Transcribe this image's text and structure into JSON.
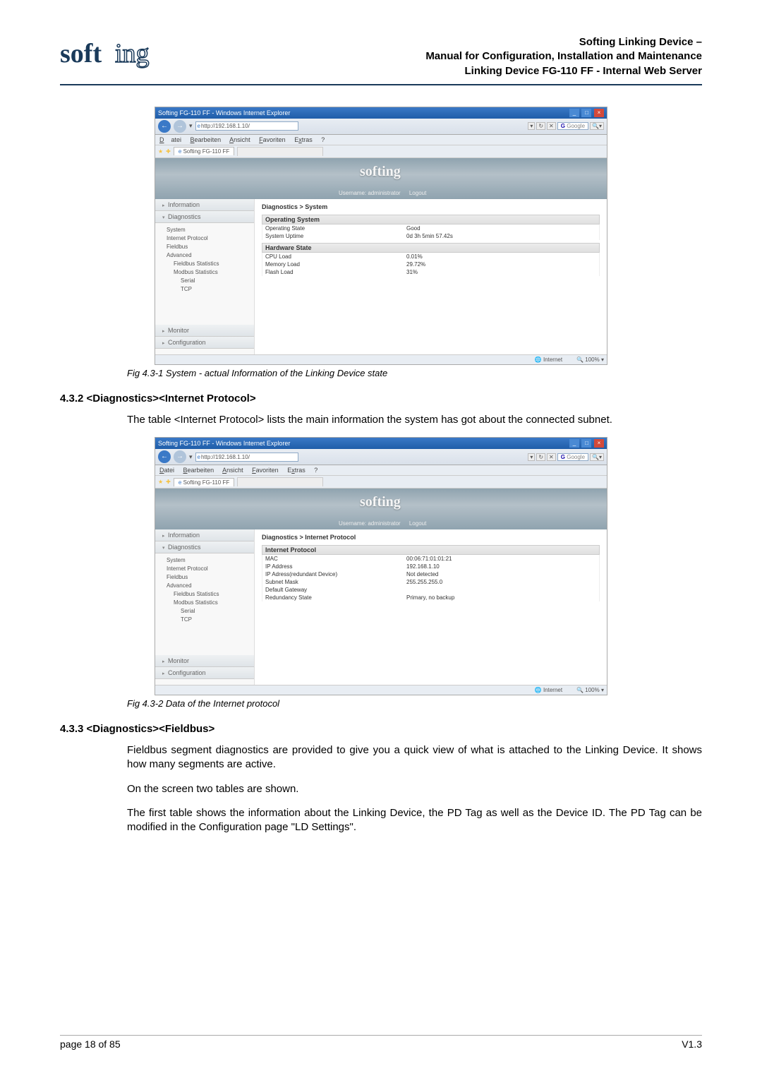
{
  "header": {
    "line1": "Softing Linking Device –",
    "line2": "Manual for Configuration, Installation and Maintenance",
    "line3": "Linking Device FG-110 FF - Internal Web Server"
  },
  "screenshot1": {
    "windowTitle": "Softing FG-110 FF - Windows Internet Explorer",
    "url": "http://192.168.1.10/",
    "searchBrand": "Google",
    "menus": {
      "datei": "Datei",
      "bearbeiten": "Bearbeiten",
      "ansicht": "Ansicht",
      "favoriten": "Favoriten",
      "extras": "Extras",
      "help": "?"
    },
    "tabLabel": "Softing FG-110 FF",
    "softingLogo": "softing",
    "userLabel": "Username:",
    "userName": "administrator",
    "logout": "Logout",
    "nav": {
      "information": "Information",
      "diagnostics": "Diagnostics",
      "items": {
        "system": "System",
        "ip": "Internet Protocol",
        "fieldbus": "Fieldbus",
        "advanced": "Advanced",
        "fbstats": "Fieldbus Statistics",
        "mbstats": "Modbus Statistics",
        "serial": "Serial",
        "tcp": "TCP"
      },
      "monitor": "Monitor",
      "config": "Configuration"
    },
    "bc": "Diagnostics > System",
    "os": {
      "header": "Operating System",
      "stateK": "Operating State",
      "stateV": "Good",
      "uptimeK": "System Uptime",
      "uptimeV": "0d 3h 5min 57.42s"
    },
    "hw": {
      "header": "Hardware State",
      "cpuK": "CPU Load",
      "cpuV": "0.01%",
      "memK": "Memory Load",
      "memV": "29.72%",
      "flashK": "Flash Load",
      "flashV": "31%"
    },
    "status": {
      "zone": "Internet",
      "zoom": "100%",
      "mode": ""
    }
  },
  "caption1": "Fig 4.3-1  System - actual Information of the Linking Device state",
  "sec432": {
    "heading": "4.3.2  <Diagnostics><Internet Protocol>",
    "para": "The table <Internet Protocol> lists the main information the system has got about the connected subnet."
  },
  "screenshot2": {
    "windowTitle": "Softing FG-110 FF - Windows Internet Explorer",
    "url": "http://192.168.1.10/",
    "searchBrand": "Google",
    "menus": {
      "datei": "Datei",
      "bearbeiten": "Bearbeiten",
      "ansicht": "Ansicht",
      "favoriten": "Favoriten",
      "extras": "Extras",
      "help": "?"
    },
    "tabLabel": "Softing FG-110 FF",
    "softingLogo": "softing",
    "userLabel": "Username:",
    "userName": "administrator",
    "logout": "Logout",
    "nav": {
      "information": "Information",
      "diagnostics": "Diagnostics",
      "items": {
        "system": "System",
        "ip": "Internet Protocol",
        "fieldbus": "Fieldbus",
        "advanced": "Advanced",
        "fbstats": "Fieldbus Statistics",
        "mbstats": "Modbus Statistics",
        "serial": "Serial",
        "tcp": "TCP"
      },
      "monitor": "Monitor",
      "config": "Configuration"
    },
    "bc": "Diagnostics > Internet Protocol",
    "ip": {
      "header": "Internet Protocol",
      "macK": "MAC",
      "macV": "00:06:71:01:01:21",
      "addrK": "IP Address",
      "addrV": "192.168.1.10",
      "redK": "IP Adress(redundant Device)",
      "redV": "Not detected",
      "maskK": "Subnet Mask",
      "maskV": "255.255.255.0",
      "gwK": "Default Gateway",
      "gwV": "",
      "rsK": "Redundancy State",
      "rsV": "Primary, no backup"
    },
    "status": {
      "zone": "Internet",
      "zoom": "100%"
    }
  },
  "caption2": "Fig 4.3-2  Data of the Internet protocol",
  "sec433": {
    "heading": "4.3.3  <Diagnostics><Fieldbus>",
    "para1": "Fieldbus segment diagnostics are provided to give you a quick view of what is attached to the Linking Device. It shows how many segments are active.",
    "para2": "On the screen two tables are shown.",
    "para3": "The first table shows the information about the Linking Device, the PD Tag as well as the Device ID. The PD Tag can be modified in the Configuration page \"LD Settings\"."
  },
  "footer": {
    "page": "page 18 of 85",
    "ver": "V1.3"
  }
}
